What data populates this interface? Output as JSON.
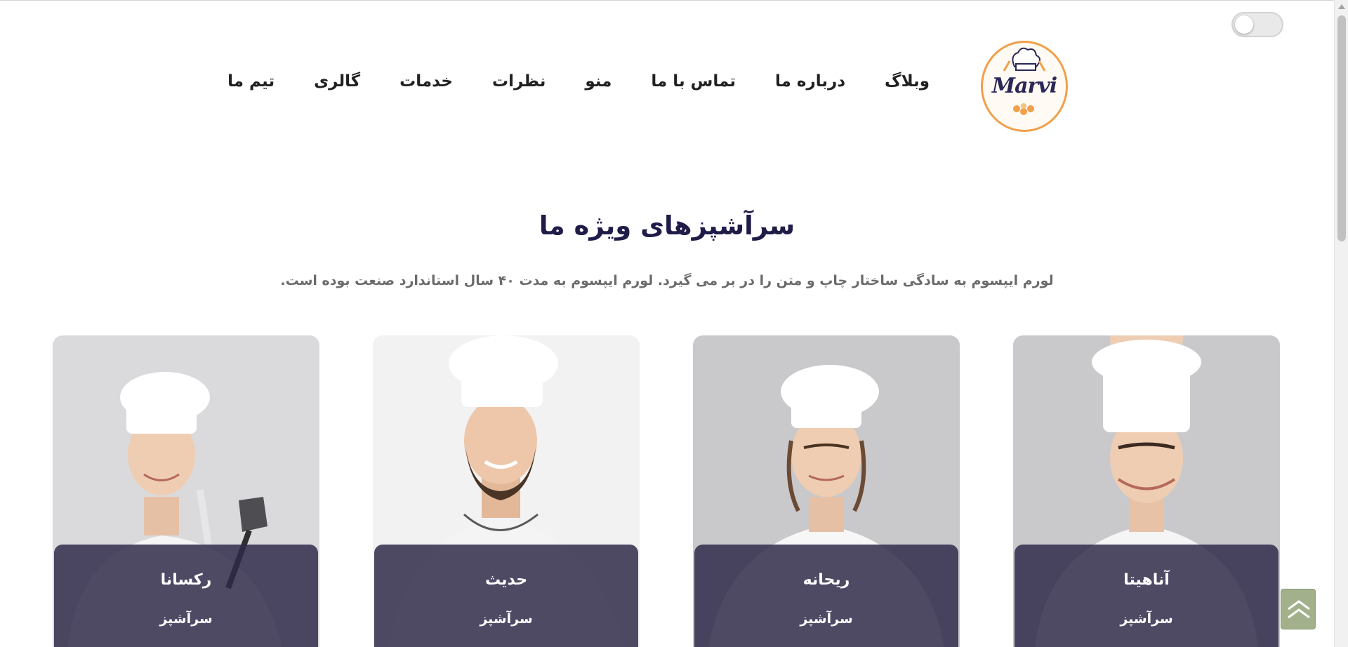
{
  "nav": {
    "items": [
      {
        "label": "وبلاگ"
      },
      {
        "label": "درباره ما"
      },
      {
        "label": "تماس با ما"
      },
      {
        "label": "منو"
      },
      {
        "label": "نظرات"
      },
      {
        "label": "خدمات"
      },
      {
        "label": "گالری"
      },
      {
        "label": "تیم ما"
      }
    ]
  },
  "logo": {
    "text": "Marvi",
    "icon": "chef-hat-logo-icon"
  },
  "theme_toggle": {
    "state": "off",
    "icon": "toggle-switch"
  },
  "section": {
    "title": "سرآشپزهای ویژه ما",
    "subtitle": "لورم ایپسوم به سادگی ساختار چاپ و متن را در بر می گیرد. لورم ایپسوم به مدت ۴۰ سال استاندارد صنعت بوده است."
  },
  "chefs": [
    {
      "name": "آناهیتا",
      "role": "سرآشپز"
    },
    {
      "name": "ریحانه",
      "role": "سرآشپز"
    },
    {
      "name": "حدیث",
      "role": "سرآشپز"
    },
    {
      "name": "رکسانا",
      "role": "سرآشپز"
    }
  ],
  "back_to_top": {
    "icon": "double-chevron-up-icon"
  },
  "colors": {
    "accent": "#f0a04b",
    "heading": "#1f1c48",
    "overlay": "#2f2848",
    "back_to_top": "#a3b08c"
  }
}
